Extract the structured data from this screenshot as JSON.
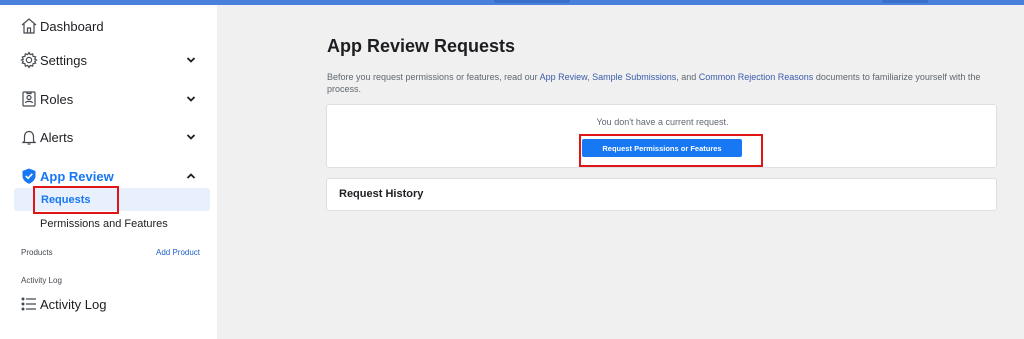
{
  "sidebar": {
    "dashboard": {
      "label": "Dashboard",
      "icon": "home-icon"
    },
    "settings": {
      "label": "Settings",
      "icon": "gear-icon"
    },
    "roles": {
      "label": "Roles",
      "icon": "id-badge-icon"
    },
    "alerts": {
      "label": "Alerts",
      "icon": "bell-icon"
    },
    "app_review": {
      "label": "App Review",
      "icon": "shield-check-icon",
      "sub_items": [
        {
          "label": "Requests",
          "active": true
        },
        {
          "label": "Permissions and Features",
          "active": false
        }
      ]
    },
    "products": {
      "section_label": "Products",
      "add_link": "Add Product"
    },
    "activity_log": {
      "section_label": "Activity Log",
      "label": "Activity Log",
      "icon": "list-icon"
    }
  },
  "main": {
    "title": "App Review Requests",
    "description": {
      "prefix": "Before you request permissions or features, read our ",
      "link1": "App Review",
      "sep1": ", ",
      "link2": "Sample Submissions",
      "sep2": ", and ",
      "link3": "Common Rejection Reasons",
      "suffix": " documents to familiarize yourself with the process."
    },
    "current_request": {
      "empty_text": "You don't have a current request.",
      "button_label": "Request Permissions or Features"
    },
    "history": {
      "title": "Request History"
    }
  },
  "colors": {
    "accent": "#1877f2",
    "link": "#3b5bab",
    "highlight": "#e01515",
    "top_bar": "#4a7fdb"
  }
}
